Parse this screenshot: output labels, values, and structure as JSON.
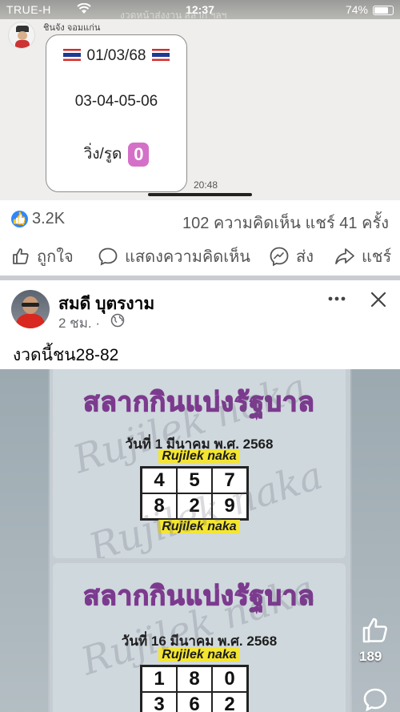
{
  "status_bar": {
    "carrier": "TRUE-H",
    "time": "12:37",
    "battery": "74%",
    "obscured_text": "งวดหน้าส่งงาน สลาก ฯลฯ"
  },
  "shared_chat": {
    "sender_name": "ชินจัง จอมแก่น",
    "date": "01/03/68",
    "numbers": "03-04-05-06",
    "run_label": "วิ่ง/รูด",
    "run_digit": "0",
    "message_time": "20:48"
  },
  "reactions": {
    "like_count": "3.2K",
    "comments_shares": "102 ความคิดเห็น  แชร์ 41 ครั้ง"
  },
  "actions": {
    "like": "ถูกใจ",
    "comment": "แสดงความคิดเห็น",
    "send": "ส่ง",
    "share": "แชร์"
  },
  "post": {
    "author": "สมดี บุตรงาม",
    "time": "2 ชม. ·",
    "text": "งวดนี้ชน28-82",
    "floating_like_count": "189",
    "cards": [
      {
        "title": "สลากกินแบ่งรัฐบาล",
        "date": "วันที่ 1 มีนาคม พ.ศ. 2568",
        "brand_top": "Rujilek naka",
        "brand_bottom": "Rujilek naka",
        "grid": [
          "4",
          "5",
          "7",
          "8",
          "2",
          "9"
        ]
      },
      {
        "title": "สลากกินแบ่งรัฐบาล",
        "date": "วันที่ 16 มีนาคม พ.ศ. 2568",
        "brand_top": "Rujilek naka",
        "grid": [
          "1",
          "8",
          "0",
          "3",
          "6",
          "2"
        ]
      }
    ],
    "watermark": "Rujilek naka"
  },
  "icons": {
    "like": "thumbs-up-icon",
    "comment": "comment-bubble-icon",
    "send": "messenger-icon",
    "share": "share-arrow-icon",
    "privacy": "globe-icon",
    "more": "more-dots-icon",
    "close": "close-icon"
  },
  "colors": {
    "facebook_blue": "#2d88ff",
    "text_secondary": "#65676b",
    "divider": "#c9ccd1"
  }
}
